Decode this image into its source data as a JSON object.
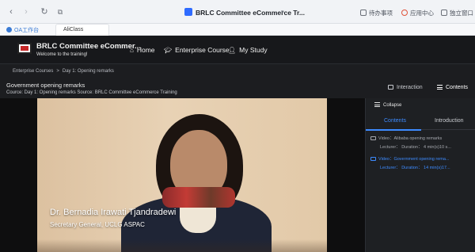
{
  "browser": {
    "back_icon": "chevron-left-icon",
    "forward_icon": "chevron-right-icon",
    "tab_title": "BRLC Committee eCommerce Tr...",
    "tool_todo": "待办事项",
    "tool_appcenter": "应用中心",
    "tool_window": "独立窗口"
  },
  "bookmarks": {
    "item1": "OA工作台",
    "item2": "AliClass"
  },
  "header": {
    "app_title": "BRLC Committee eCommer...",
    "app_subtitle": "Welcome to the training!",
    "nav_home": "Home",
    "nav_enterprise": "Enterprise Course",
    "nav_mystudy": "My Study"
  },
  "breadcrumb": {
    "item1": "Enterprise Courses",
    "separator": ">",
    "item2": "Day 1: Opening remarks"
  },
  "course": {
    "title": "Government opening remarks",
    "meta": "Cource: Day 1: Opening remarks   Source: BRLC Committee eCommerce Training",
    "interaction_label": "Interaction",
    "contents_label": "Contents"
  },
  "video": {
    "caption_name": "Dr. Bernadia Irawati Tjandradewi",
    "caption_role": "Secretary General, UCLG ASPAC"
  },
  "sidebar": {
    "collapse_label": "Collapse",
    "tab_contents": "Contents",
    "tab_introduction": "Introduction",
    "lessons": [
      {
        "title": "Video：Alibaba opening remarks",
        "detail": "Lecturer：  Duration： 4 min(s)10 s..."
      },
      {
        "title": "Video：Government opening rema...",
        "detail": "Lecturer：  Duration： 14 min(s)17..."
      }
    ]
  },
  "colors": {
    "accent": "#3d8bff",
    "background": "#1c1d20"
  }
}
